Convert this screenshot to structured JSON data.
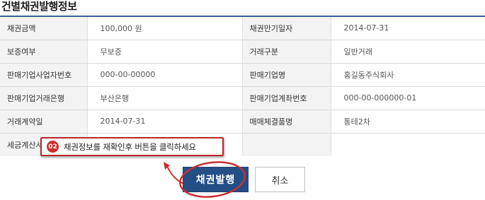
{
  "section_title": "건별채권발행정보",
  "rows": [
    {
      "label1": "채권금액",
      "value1": "100,000 원",
      "label2": "채권만기일자",
      "value2": "2014-07-31"
    },
    {
      "label1": "보증여부",
      "value1": "무보증",
      "label2": "거래구분",
      "value2": "일반거래"
    },
    {
      "label1": "판매기업사업자번호",
      "value1": "000-00-00000",
      "label2": "판매기업명",
      "value2": "홍길동주식회사"
    },
    {
      "label1": "판매기업거래은행",
      "value1": "부산은행",
      "label2": "판매기업계좌번호",
      "value2": "000-00-000000-01"
    },
    {
      "label1": "거래계약일",
      "value1": "2014-07-31",
      "label2": "매매체결품명",
      "value2": "통테2차"
    },
    {
      "label1": "세금계산서발행일",
      "value1": "",
      "label2": "",
      "value2": ""
    }
  ],
  "hint": {
    "step": "02",
    "text": "채권정보를 재확인후 버튼을 클릭하세요"
  },
  "buttons": {
    "issue_label": "채권발행",
    "cancel_label": "취소"
  },
  "colors": {
    "accent": "#244f86",
    "annotation_red": "#c8302f"
  }
}
